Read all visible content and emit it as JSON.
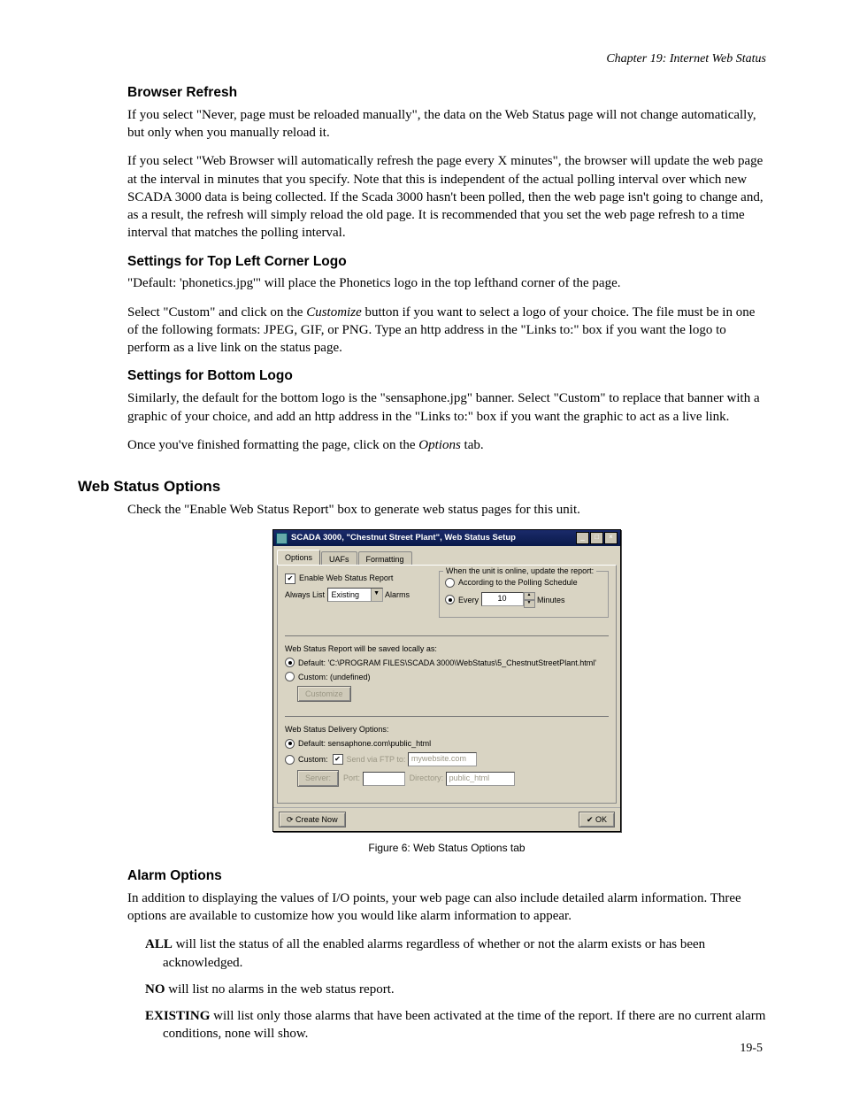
{
  "header": {
    "chapter_line": "Chapter 19: Internet Web Status"
  },
  "sec_browser_refresh": {
    "heading": "Browser Refresh",
    "p1": "If you select \"Never, page must be reloaded manually\", the data on the Web Status page will not change automatically, but only when you manually reload it.",
    "p2": "If you select \"Web Browser will automatically refresh the page every X minutes\", the browser will update the web page at the interval in minutes that you specify. Note that this is independent of the actual polling interval over which new SCADA 3000 data is being collected.  If the Scada 3000 hasn't been polled, then the web page isn't going to change and, as a result, the refresh will simply reload the old page. It is recommended that you set the web page refresh to a time interval that matches the polling interval."
  },
  "sec_top_logo": {
    "heading": "Settings for Top Left Corner Logo",
    "p1": "\"Default: 'phonetics.jpg'\" will place the Phonetics logo in the top lefthand corner of the page.",
    "p2a": "Select \"Custom\" and click on the ",
    "p2_italic": "Customize",
    "p2b": " button if you want to select a logo of your choice. The file must be in one of the following formats: JPEG, GIF, or PNG. Type an http address in the \"Links to:\" box if you want the logo to perform as a live link on the status page."
  },
  "sec_bottom_logo": {
    "heading": "Settings for Bottom Logo",
    "p1": "Similarly, the default for the bottom logo is the \"sensaphone.jpg\" banner.  Select \"Custom\" to replace that banner with a graphic of your choice, and add an http address in the \"Links to:\" box if you want the graphic to act as a live link.",
    "p2a": "Once you've finished formatting the page, click on the ",
    "p2_italic": "Options",
    "p2b": " tab."
  },
  "sec_web_status_options": {
    "heading": "Web Status Options",
    "p1": "Check the \"Enable Web Status Report\" box to generate web status pages for this unit."
  },
  "dialog": {
    "title": "SCADA 3000, \"Chestnut Street Plant\", Web Status Setup",
    "winbtns": {
      "min": "_",
      "max": "□",
      "close": "×"
    },
    "tabs": {
      "options": "Options",
      "uafs": "UAFs",
      "formatting": "Formatting"
    },
    "enable_label": "Enable Web Status Report",
    "always_list_label": "Always List",
    "always_list_value": "Existing",
    "always_list_suffix": "Alarms",
    "update_group": {
      "title": "When the unit is online, update the report:",
      "opt_polling": "According to the Polling Schedule",
      "opt_every_prefix": "Every",
      "opt_every_value": "10",
      "opt_every_suffix": "Minutes"
    },
    "save_group": {
      "title": "Web Status Report will be saved locally as:",
      "default_label": "Default: 'C:\\PROGRAM FILES\\SCADA 3000\\WebStatus\\5_ChestnutStreetPlant.html'",
      "custom_label": "Custom: (undefined)",
      "customize_btn": "Customize"
    },
    "delivery_group": {
      "title": "Web Status Delivery Options:",
      "default_label": "Default: sensaphone.com\\public_html",
      "custom_label": "Custom:",
      "send_ftp_label": "Send via FTP to:",
      "host_value": "mywebsite.com",
      "server_label": "Server:",
      "port_label": "Port:",
      "port_value": "",
      "dir_label": "Directory:",
      "dir_value": "public_html"
    },
    "create_now": "Create Now",
    "ok": "OK"
  },
  "figure_caption": "Figure 6: Web Status Options tab",
  "sec_alarm_options": {
    "heading": "Alarm Options",
    "p1": "In addition to displaying the values of I/O points, your web page can also include detailed alarm information. Three options are available to customize how you would like alarm information to appear.",
    "all_bold": "ALL",
    "all_text": " will list the status of all the enabled alarms regardless of whether or not the alarm exists or has been acknowledged.",
    "no_bold": "NO",
    "no_text": " will list no alarms in the web status report.",
    "existing_bold": "EXISTING",
    "existing_text": " will list only those alarms that have been activated at the time of the report. If there are no current alarm conditions, none will show."
  },
  "page_number": "19-5"
}
